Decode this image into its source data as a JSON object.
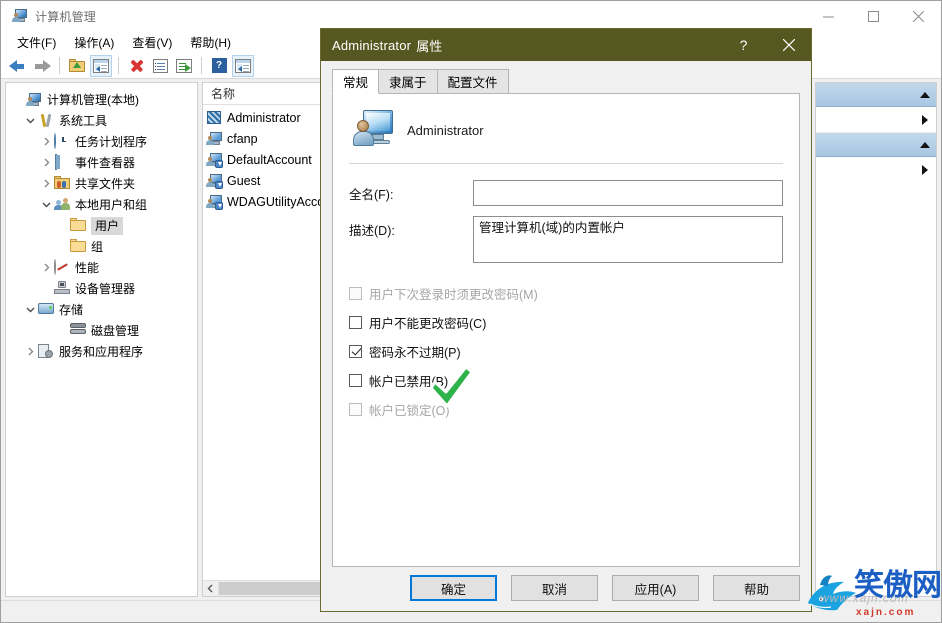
{
  "window": {
    "title": "计算机管理",
    "app_icon": "computer-management-icon",
    "controls": {
      "minimize": "—",
      "maximize": "▢",
      "close": "✕"
    }
  },
  "menubar": [
    {
      "label": "文件(F)"
    },
    {
      "label": "操作(A)"
    },
    {
      "label": "查看(V)"
    },
    {
      "label": "帮助(H)"
    }
  ],
  "toolbar": [
    {
      "name": "back-arrow-icon"
    },
    {
      "name": "forward-arrow-icon"
    },
    {
      "name": "up-folder-icon"
    },
    {
      "name": "show-console-tree-icon"
    },
    {
      "name": "delete-icon"
    },
    {
      "name": "properties-icon"
    },
    {
      "name": "export-list-icon"
    },
    {
      "name": "help-icon"
    },
    {
      "name": "show-action-pane-icon"
    }
  ],
  "tree": {
    "root": "计算机管理(本地)",
    "items": [
      {
        "label": "系统工具",
        "level": 1,
        "twisty": "down",
        "icon": "wrench-icon",
        "selected": false
      },
      {
        "label": "任务计划程序",
        "level": 2,
        "twisty": "right",
        "icon": "clock-icon",
        "selected": false
      },
      {
        "label": "事件查看器",
        "level": 2,
        "twisty": "right",
        "icon": "event-viewer-icon",
        "selected": false
      },
      {
        "label": "共享文件夹",
        "level": 2,
        "twisty": "right",
        "icon": "shared-folders-icon",
        "selected": false
      },
      {
        "label": "本地用户和组",
        "level": 2,
        "twisty": "down",
        "icon": "local-users-icon",
        "selected": false
      },
      {
        "label": "用户",
        "level": 3,
        "twisty": "none",
        "icon": "folder-icon",
        "selected": true
      },
      {
        "label": "组",
        "level": 3,
        "twisty": "none",
        "icon": "folder-icon",
        "selected": false
      },
      {
        "label": "性能",
        "level": 2,
        "twisty": "right",
        "icon": "performance-icon",
        "selected": false
      },
      {
        "label": "设备管理器",
        "level": 2,
        "twisty": "none",
        "icon": "device-manager-icon",
        "selected": false
      },
      {
        "label": "存储",
        "level": 1,
        "twisty": "down",
        "icon": "storage-icon",
        "selected": false
      },
      {
        "label": "磁盘管理",
        "level": 2,
        "twisty": "none",
        "icon": "disk-management-icon",
        "selected": false
      },
      {
        "label": "服务和应用程序",
        "level": 1,
        "twisty": "right",
        "icon": "services-icon",
        "selected": false
      }
    ]
  },
  "list": {
    "columns": [
      "名称",
      ""
    ],
    "rows": [
      {
        "name": "Administrator",
        "icon": "administrator-icon"
      },
      {
        "name": "cfanp",
        "icon": "user-icon"
      },
      {
        "name": "DefaultAccount",
        "icon": "user-disabled-icon"
      },
      {
        "name": "Guest",
        "icon": "user-disabled-icon"
      },
      {
        "name": "WDAGUtilityAcco",
        "icon": "user-disabled-icon"
      }
    ]
  },
  "actions_pane": {
    "groups": [
      {
        "type": "group",
        "caption": ""
      },
      {
        "type": "row",
        "caption": ""
      },
      {
        "type": "group",
        "caption": ""
      },
      {
        "type": "row",
        "caption": ""
      }
    ]
  },
  "dialog": {
    "title_name": "Administrator",
    "title_suffix": "属性",
    "help_button": "?",
    "close_button": "✕",
    "tabs": [
      {
        "label": "常规",
        "active": true
      },
      {
        "label": "隶属于",
        "active": false
      },
      {
        "label": "配置文件",
        "active": false
      }
    ],
    "account": {
      "icon": "account-user-icon",
      "name": "Administrator"
    },
    "fields": [
      {
        "label": "全名(F):",
        "value": "",
        "placeholder": "",
        "type": "text"
      },
      {
        "label": "描述(D):",
        "value": "管理计算机(域)的内置帐户",
        "placeholder": "",
        "type": "textarea"
      }
    ],
    "checkboxes": [
      {
        "label": "用户下次登录时须更改密码(M)",
        "checked": false,
        "disabled": true
      },
      {
        "label": "用户不能更改密码(C)",
        "checked": false,
        "disabled": false
      },
      {
        "label": "密码永不过期(P)",
        "checked": true,
        "disabled": false
      },
      {
        "label": "帐户已禁用(B)",
        "checked": false,
        "disabled": false
      },
      {
        "label": "帐户已锁定(O)",
        "checked": false,
        "disabled": true
      }
    ],
    "annotation": {
      "type": "green-check-mark",
      "color": "#2eb24a"
    },
    "buttons": [
      {
        "label": "确定",
        "default": true
      },
      {
        "label": "取消",
        "default": false
      },
      {
        "label": "应用(A)",
        "default": false
      },
      {
        "label": "帮助",
        "default": false
      }
    ]
  },
  "watermark": {
    "text": "笑傲网",
    "sub": "xajn.com",
    "ghost": "www.xajn.com",
    "logo": "shark-icon",
    "color": "#1c5fc4"
  },
  "colors": {
    "dialog_titlebar": "#575721",
    "accent_blue": "#0078d7",
    "selection_blue": "#a8c6e2",
    "check_green": "#2eb24a"
  }
}
